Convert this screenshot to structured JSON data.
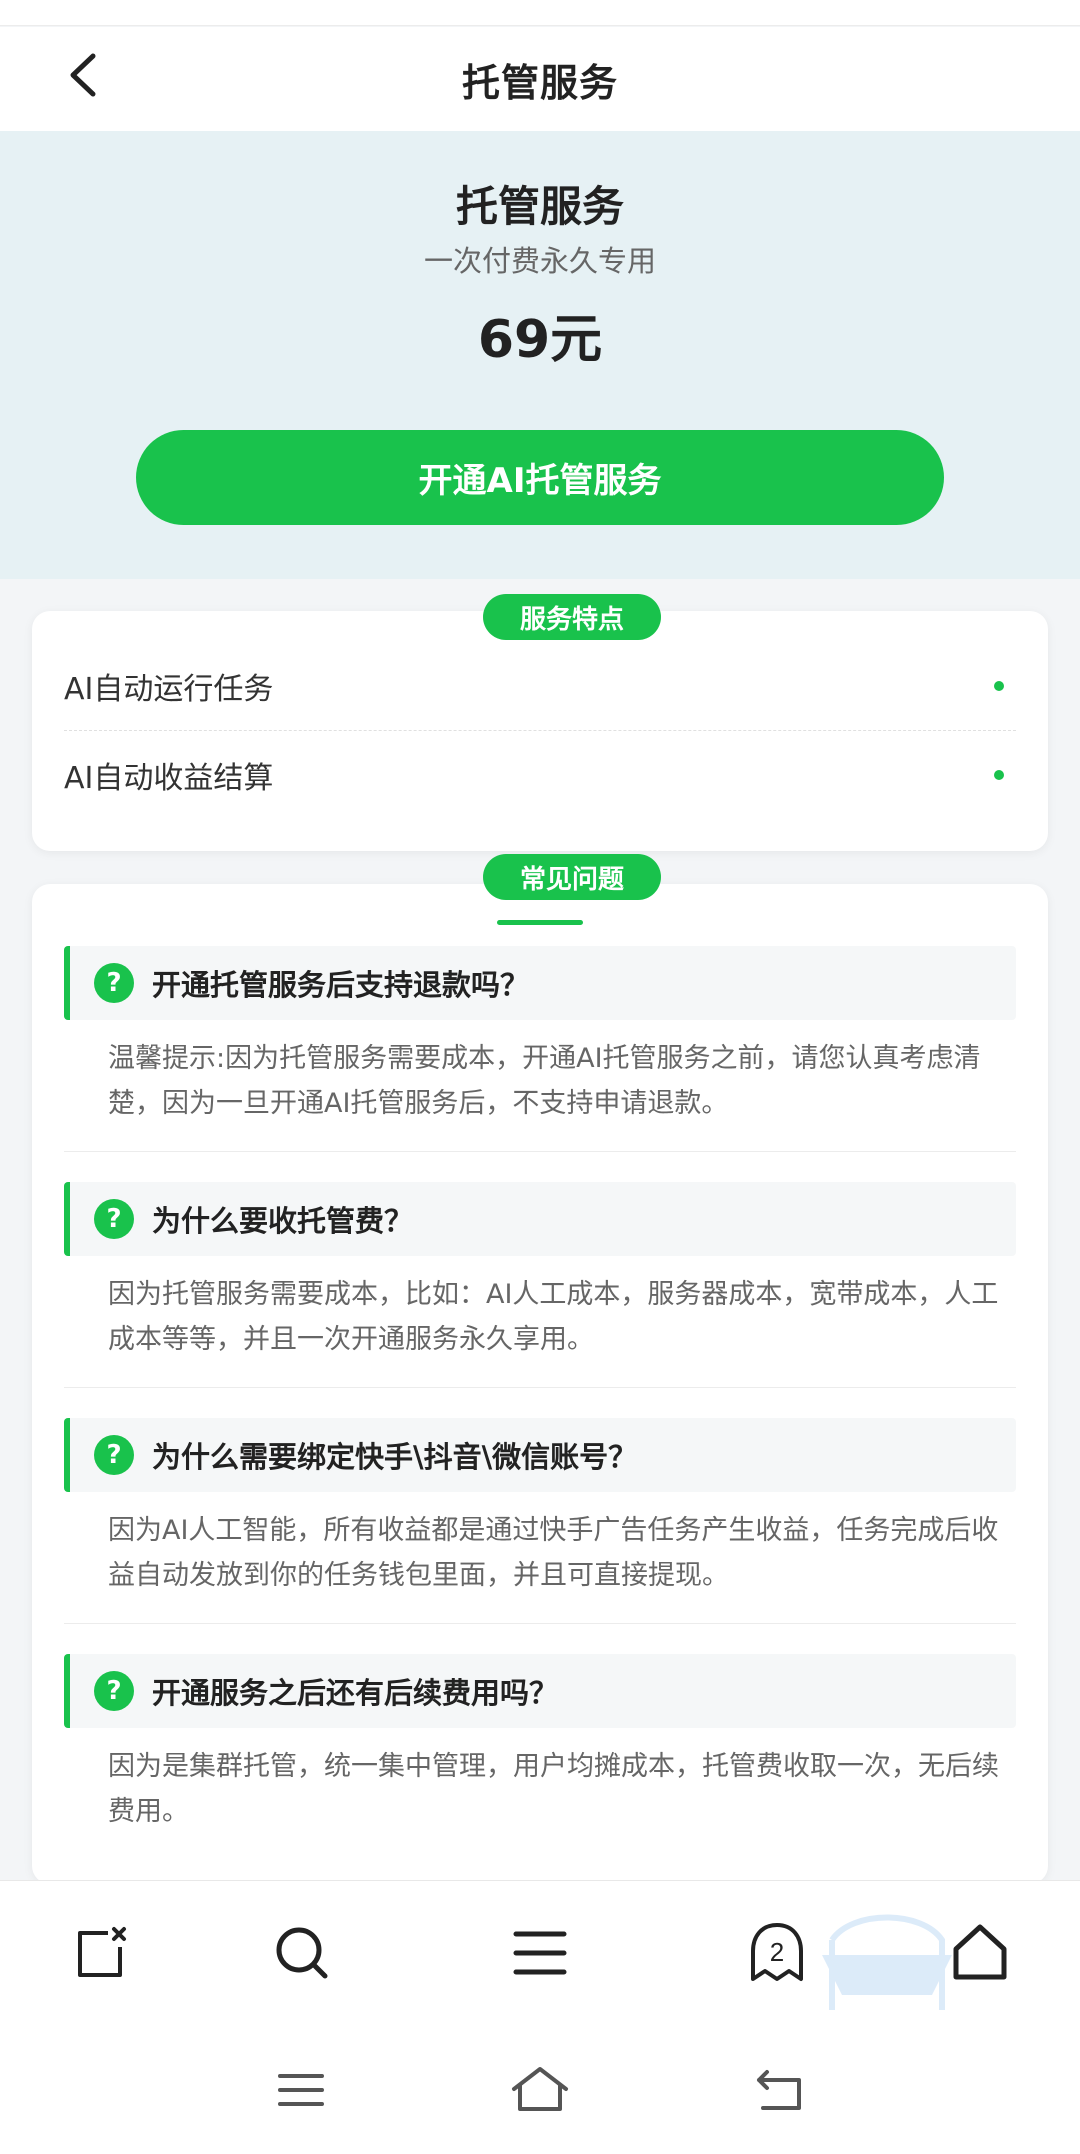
{
  "header": {
    "title": "托管服务"
  },
  "hero": {
    "title": "托管服务",
    "subtitle": "一次付费永久专用",
    "price": "69元",
    "button_label": "开通AI托管服务"
  },
  "features": {
    "label": "服务特点",
    "items": [
      {
        "text": "AI自动运行任务"
      },
      {
        "text": "AI自动收益结算"
      }
    ]
  },
  "faq": {
    "label": "常见问题",
    "items": [
      {
        "question": "开通托管服务后支持退款吗？",
        "answer": "温馨提示:因为托管服务需要成本，开通AI托管服务之前，请您认真考虑清楚，因为一旦开通AI托管服务后，不支持申请退款。"
      },
      {
        "question": "为什么要收托管费？",
        "answer": "因为托管服务需要成本，比如：AI人工成本，服务器成本，宽带成本，人工成本等等，并且一次开通服务永久享用。"
      },
      {
        "question": "为什么需要绑定快手\\抖音\\微信账号？",
        "answer": "因为AI人工智能，所有收益都是通过快手广告任务产生收益，任务完成后收益自动发放到你的任务钱包里面，并且可直接提现。"
      },
      {
        "question": "开通服务之后还有后续费用吗？",
        "answer": "因为是集群托管，统一集中管理，用户均摊成本，托管费收取一次，无后续费用。"
      }
    ],
    "question_mark": "?"
  },
  "bottom_nav": {
    "tab_count": "2"
  },
  "colors": {
    "accent": "#19c24c",
    "hero_bg": "#e6f1f4"
  }
}
